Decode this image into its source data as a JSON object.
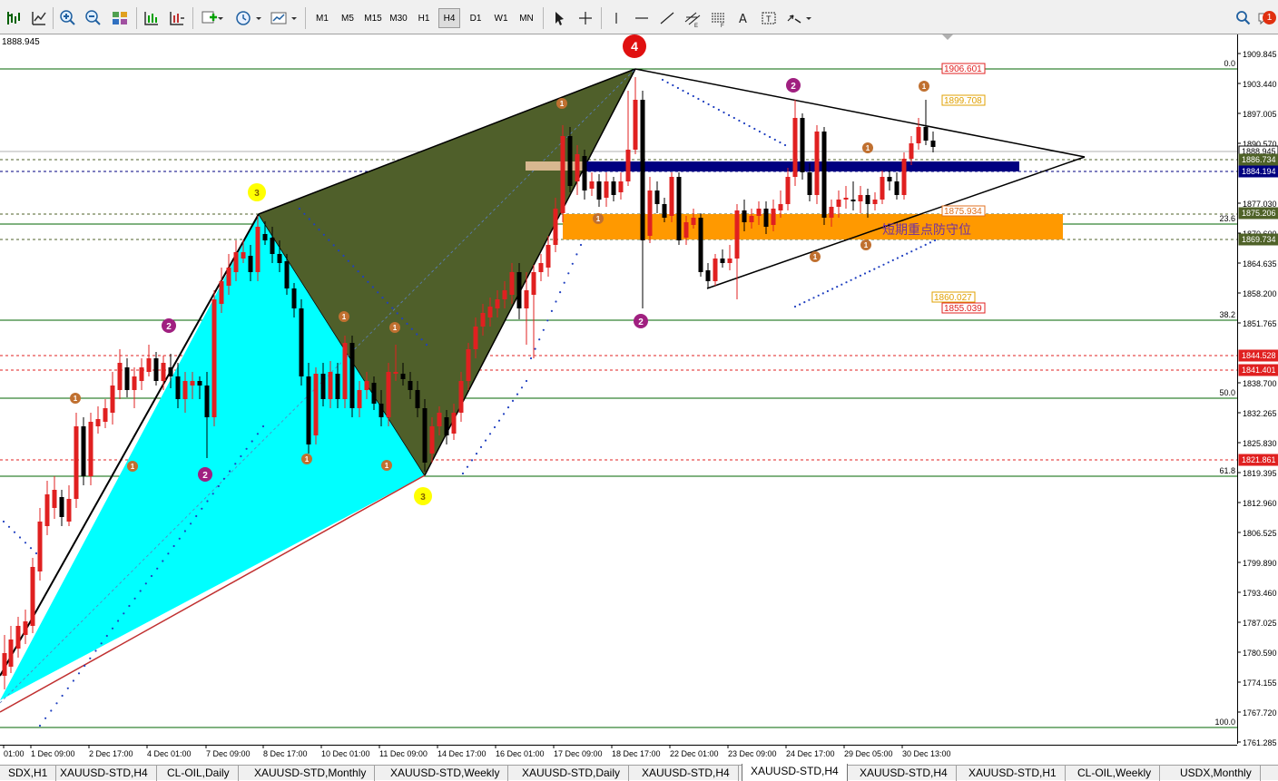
{
  "toolbar": {
    "timeframes": [
      "M1",
      "M5",
      "M15",
      "M30",
      "H1",
      "H4",
      "D1",
      "W1",
      "MN"
    ],
    "active_timeframe": "H4",
    "notification_count": "1"
  },
  "chart": {
    "current_price_label": "1888.945",
    "price_ticks": [
      "1909.845",
      "1903.440",
      "1897.005",
      "1890.570",
      "1877.030",
      "1870.600",
      "1864.635",
      "1858.200",
      "1851.765",
      "1838.700",
      "1832.265",
      "1825.830",
      "1819.395",
      "1812.960",
      "1806.525",
      "1799.890",
      "1793.460",
      "1787.025",
      "1780.590",
      "1774.155",
      "1767.720",
      "1761.285"
    ],
    "time_ticks": [
      "01:00",
      "1 Dec 09:00",
      "2 Dec 17:00",
      "4 Dec 01:00",
      "7 Dec 09:00",
      "8 Dec 17:00",
      "10 Dec 01:00",
      "11 Dec 09:00",
      "14 Dec 17:00",
      "16 Dec 01:00",
      "17 Dec 09:00",
      "18 Dec 17:00",
      "22 Dec 01:00",
      "23 Dec 09:00",
      "24 Dec 17:00",
      "29 Dec 05:00",
      "30 Dec 13:00"
    ],
    "fib_levels": [
      {
        "label": "0.0"
      },
      {
        "label": "23.6"
      },
      {
        "label": "38.2"
      },
      {
        "label": "50.0"
      },
      {
        "label": "61.8"
      },
      {
        "label": "100.0"
      }
    ],
    "price_boxes": [
      {
        "label": "1888.945",
        "bg": "#ffffff",
        "fg": "#000000",
        "border": "#000000"
      },
      {
        "label": "1886.734",
        "bg": "#4f6228",
        "fg": "#ffffff",
        "border": "#4f6228"
      },
      {
        "label": "1884.194",
        "bg": "#000080",
        "fg": "#ffffff",
        "border": "#000080"
      },
      {
        "label": "1875.206",
        "bg": "#4f6228",
        "fg": "#ffffff",
        "border": "#4f6228"
      },
      {
        "label": "1869.734",
        "bg": "#4f6228",
        "fg": "#ffffff",
        "border": "#4f6228"
      },
      {
        "label": "1844.528",
        "bg": "#e02020",
        "fg": "#ffffff",
        "border": "#e02020"
      },
      {
        "label": "1841.401",
        "bg": "#e02020",
        "fg": "#ffffff",
        "border": "#e02020"
      },
      {
        "label": "1821.861",
        "bg": "#e02020",
        "fg": "#ffffff",
        "border": "#e02020"
      }
    ],
    "chart_labels": [
      {
        "text": "1906.601",
        "color": "#e02020"
      },
      {
        "text": "1899.708",
        "color": "#e0a000"
      },
      {
        "text": "1875.934",
        "color": "#e07020"
      },
      {
        "text": "1860.027",
        "color": "#e0a000"
      },
      {
        "text": "1855.039",
        "color": "#e02020"
      }
    ],
    "zone_label": "短期重点防守位",
    "wave_labels": [
      "4",
      "3",
      "3",
      "2",
      "2",
      "2",
      "2"
    ],
    "sub_labels": [
      "1",
      "1",
      "1",
      "1",
      "1",
      "1",
      "1",
      "1",
      "1",
      "1",
      "1",
      "1"
    ]
  },
  "tabs": [
    "SDX,H1",
    "XAUUSD-STD,H4",
    "CL-OIL,Daily",
    "XAUUSD-STD,Monthly",
    "XAUUSD-STD,Weekly",
    "XAUUSD-STD,Daily",
    "XAUUSD-STD,H4",
    "XAUUSD-STD,H4",
    "XAUUSD-STD,H4",
    "XAUUSD-STD,H1",
    "CL-OIL,Weekly",
    "USDX,Monthly"
  ],
  "active_tab_index": 7,
  "colors": {
    "bull": "#e02020",
    "bear": "#000000",
    "cyan_triangle": "#00ffff",
    "olive_triangle": "#4f5f2a",
    "blue_zone": "#000080",
    "orange_zone": "#ff9900",
    "fib_line": "#006400"
  }
}
